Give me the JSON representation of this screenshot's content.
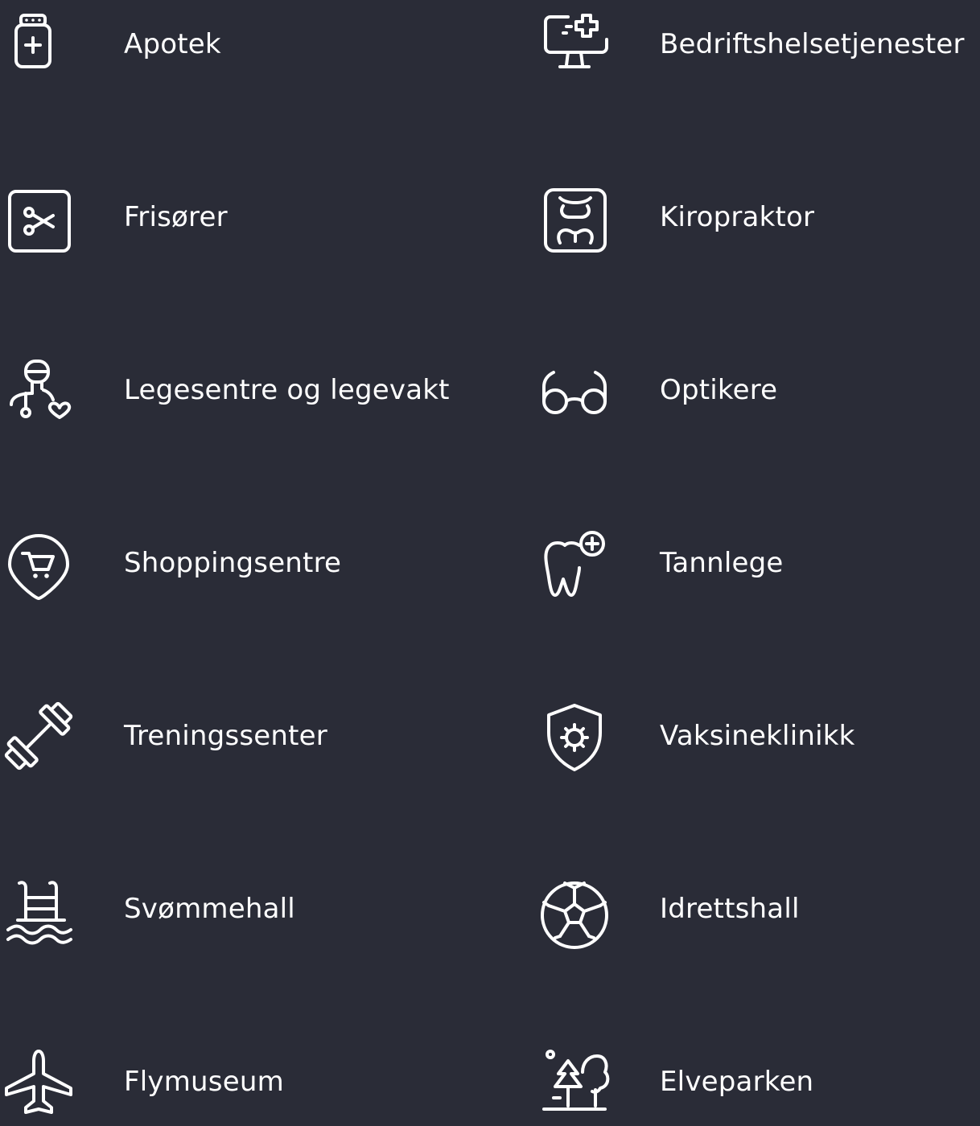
{
  "colors": {
    "background": "#2a2c37",
    "foreground": "#ffffff"
  },
  "items": [
    {
      "label": "Apotek",
      "icon": "medicine-jar-icon"
    },
    {
      "label": "Bedriftshelsetjenester",
      "icon": "medical-monitor-icon"
    },
    {
      "label": "Frisører",
      "icon": "scissors-icon"
    },
    {
      "label": "Kiropraktor",
      "icon": "spine-icon"
    },
    {
      "label": "Legesentre og legevakt",
      "icon": "doctor-stethoscope-icon"
    },
    {
      "label": "Optikere",
      "icon": "glasses-icon"
    },
    {
      "label": "Shoppingsentre",
      "icon": "shopping-cart-location-icon"
    },
    {
      "label": "Tannlege",
      "icon": "tooth-plus-icon"
    },
    {
      "label": "Treningssenter",
      "icon": "dumbbell-icon"
    },
    {
      "label": "Vaksineklinikk",
      "icon": "virus-shield-icon"
    },
    {
      "label": "Svømmehall",
      "icon": "swimming-pool-icon"
    },
    {
      "label": "Idrettshall",
      "icon": "soccer-ball-icon"
    },
    {
      "label": "Flymuseum",
      "icon": "airplane-icon"
    },
    {
      "label": "Elveparken",
      "icon": "park-trees-icon"
    }
  ]
}
